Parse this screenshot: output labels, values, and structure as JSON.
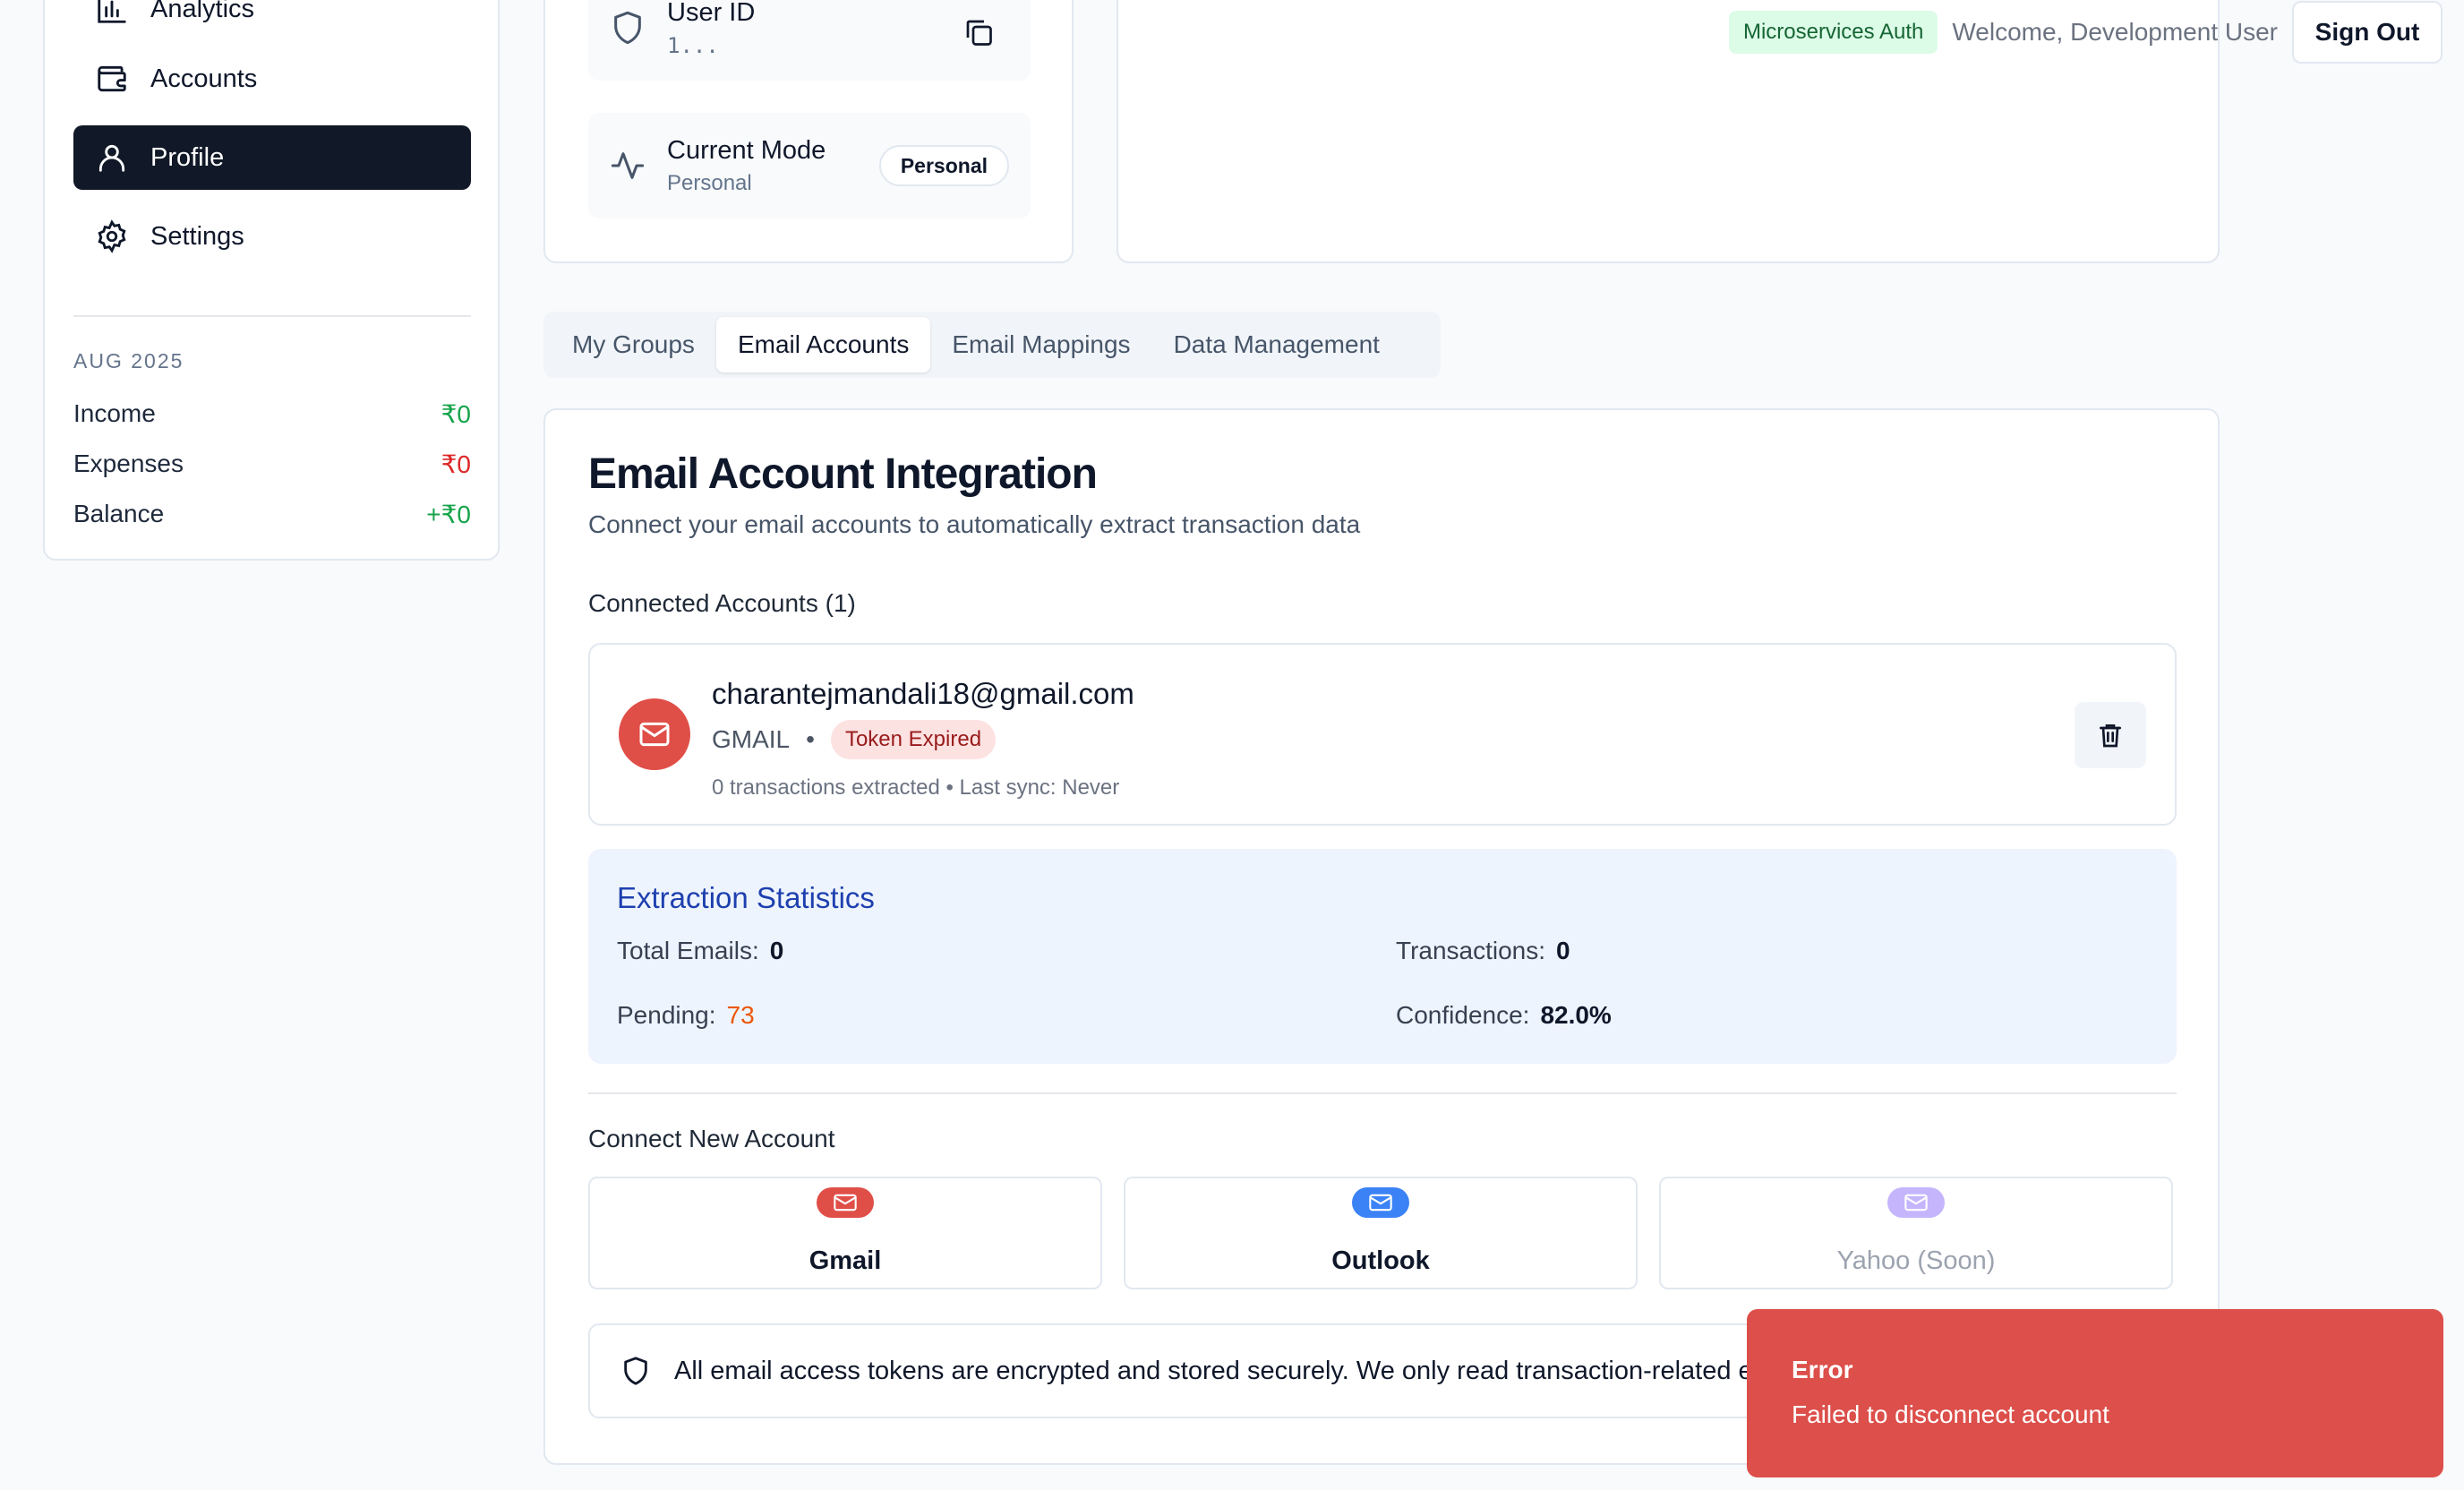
{
  "header": {
    "auth_badge": "Microservices Auth",
    "welcome": "Welcome, Development User",
    "sign_out": "Sign Out"
  },
  "sidebar": {
    "items": [
      {
        "label": "Analytics",
        "icon": "bar-chart-icon"
      },
      {
        "label": "Accounts",
        "icon": "wallet-icon"
      },
      {
        "label": "Profile",
        "icon": "user-icon",
        "active": true
      },
      {
        "label": "Settings",
        "icon": "gear-icon"
      }
    ],
    "month": "AUG 2025",
    "summary": [
      {
        "label": "Income",
        "value": "₹0"
      },
      {
        "label": "Expenses",
        "value": "₹0"
      },
      {
        "label": "Balance",
        "value": "+₹0"
      }
    ]
  },
  "profile": {
    "user_id_label": "User ID",
    "user_id_value": "1...",
    "mode_label": "Current Mode",
    "mode_value": "Personal",
    "mode_badge": "Personal"
  },
  "tabs": [
    "My Groups",
    "Email Accounts",
    "Email Mappings",
    "Data Management"
  ],
  "active_tab": "Email Accounts",
  "integration": {
    "title": "Email Account Integration",
    "subtitle": "Connect your email accounts to automatically extract transaction data",
    "connected_label": "Connected Accounts (1)",
    "account": {
      "email": "charantejmandali18@gmail.com",
      "provider": "GMAIL",
      "separator": "•",
      "status": "Token Expired",
      "footer": "0 transactions extracted • Last sync: Never"
    },
    "stats": {
      "title": "Extraction Statistics",
      "total_emails_label": "Total Emails:",
      "total_emails": "0",
      "transactions_label": "Transactions:",
      "transactions": "0",
      "pending_label": "Pending:",
      "pending": "73",
      "confidence_label": "Confidence:",
      "confidence": "82.0%"
    },
    "connect_label": "Connect New Account",
    "providers": [
      {
        "label": "Gmail",
        "color": "#e04e48"
      },
      {
        "label": "Outlook",
        "color": "#3b82f6"
      },
      {
        "label": "Yahoo (Soon)",
        "color": "#c4b5fd"
      }
    ],
    "security_note": "All email access tokens are encrypted and stored securely. We only read transaction-related emails."
  },
  "toast": {
    "title": "Error",
    "message": "Failed to disconnect account",
    "color": "#dc4f4a"
  }
}
